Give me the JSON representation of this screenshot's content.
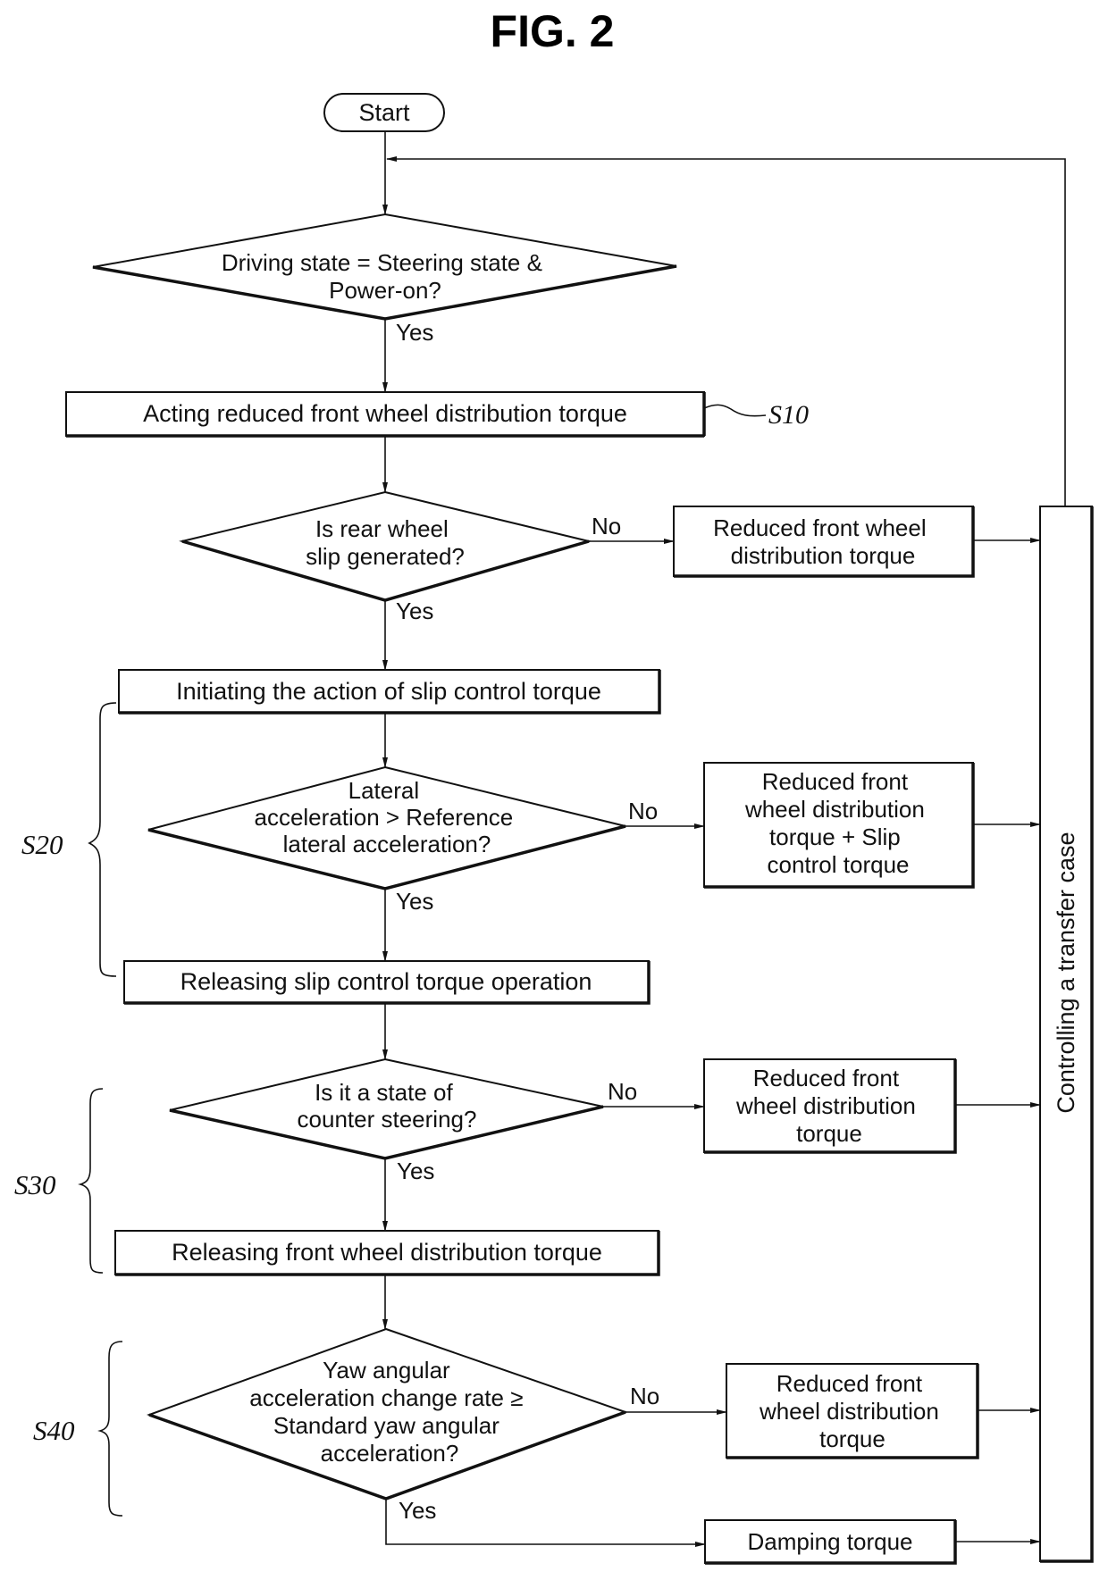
{
  "figure": {
    "title": "FIG. 2"
  },
  "start": {
    "label": "Start"
  },
  "decisions": {
    "d1": {
      "lines": [
        "Driving state = Steering state &",
        "Power-on?"
      ],
      "yes": "Yes"
    },
    "d2": {
      "lines": [
        "Is rear wheel",
        "slip generated?"
      ],
      "yes": "Yes",
      "no": "No"
    },
    "d3": {
      "lines": [
        "Lateral",
        "acceleration > Reference",
        "lateral acceleration?"
      ],
      "yes": "Yes",
      "no": "No"
    },
    "d4": {
      "lines": [
        "Is it a state of",
        "counter steering?"
      ],
      "yes": "Yes",
      "no": "No"
    },
    "d5": {
      "lines": [
        "Yaw angular",
        "acceleration change rate ≥",
        "Standard yaw angular",
        "acceleration?"
      ],
      "yes": "Yes",
      "no": "No"
    }
  },
  "processes": {
    "s10_box": {
      "lines": [
        "Acting reduced front wheel distribution torque"
      ]
    },
    "init_slip": {
      "lines": [
        "Initiating the action of slip control torque"
      ]
    },
    "release_slip": {
      "lines": [
        "Releasing slip control torque operation"
      ]
    },
    "release_front": {
      "lines": [
        "Releasing front wheel distribution torque"
      ]
    },
    "r1": {
      "lines": [
        "Reduced front wheel",
        "distribution torque"
      ]
    },
    "r2": {
      "lines": [
        "Reduced front",
        "wheel distribution",
        "torque + Slip",
        "control torque"
      ]
    },
    "r3": {
      "lines": [
        "Reduced front",
        "wheel distribution",
        "torque"
      ]
    },
    "r4": {
      "lines": [
        "Reduced front",
        "wheel distribution",
        "torque"
      ]
    },
    "damping": {
      "lines": [
        "Damping torque"
      ]
    },
    "transfer": {
      "lines": [
        "Controlling a transfer case"
      ]
    }
  },
  "step_labels": {
    "s10": "S10",
    "s20": "S20",
    "s30": "S30",
    "s40": "S40"
  },
  "colors": {
    "ink": "#111111",
    "background": "#ffffff"
  }
}
